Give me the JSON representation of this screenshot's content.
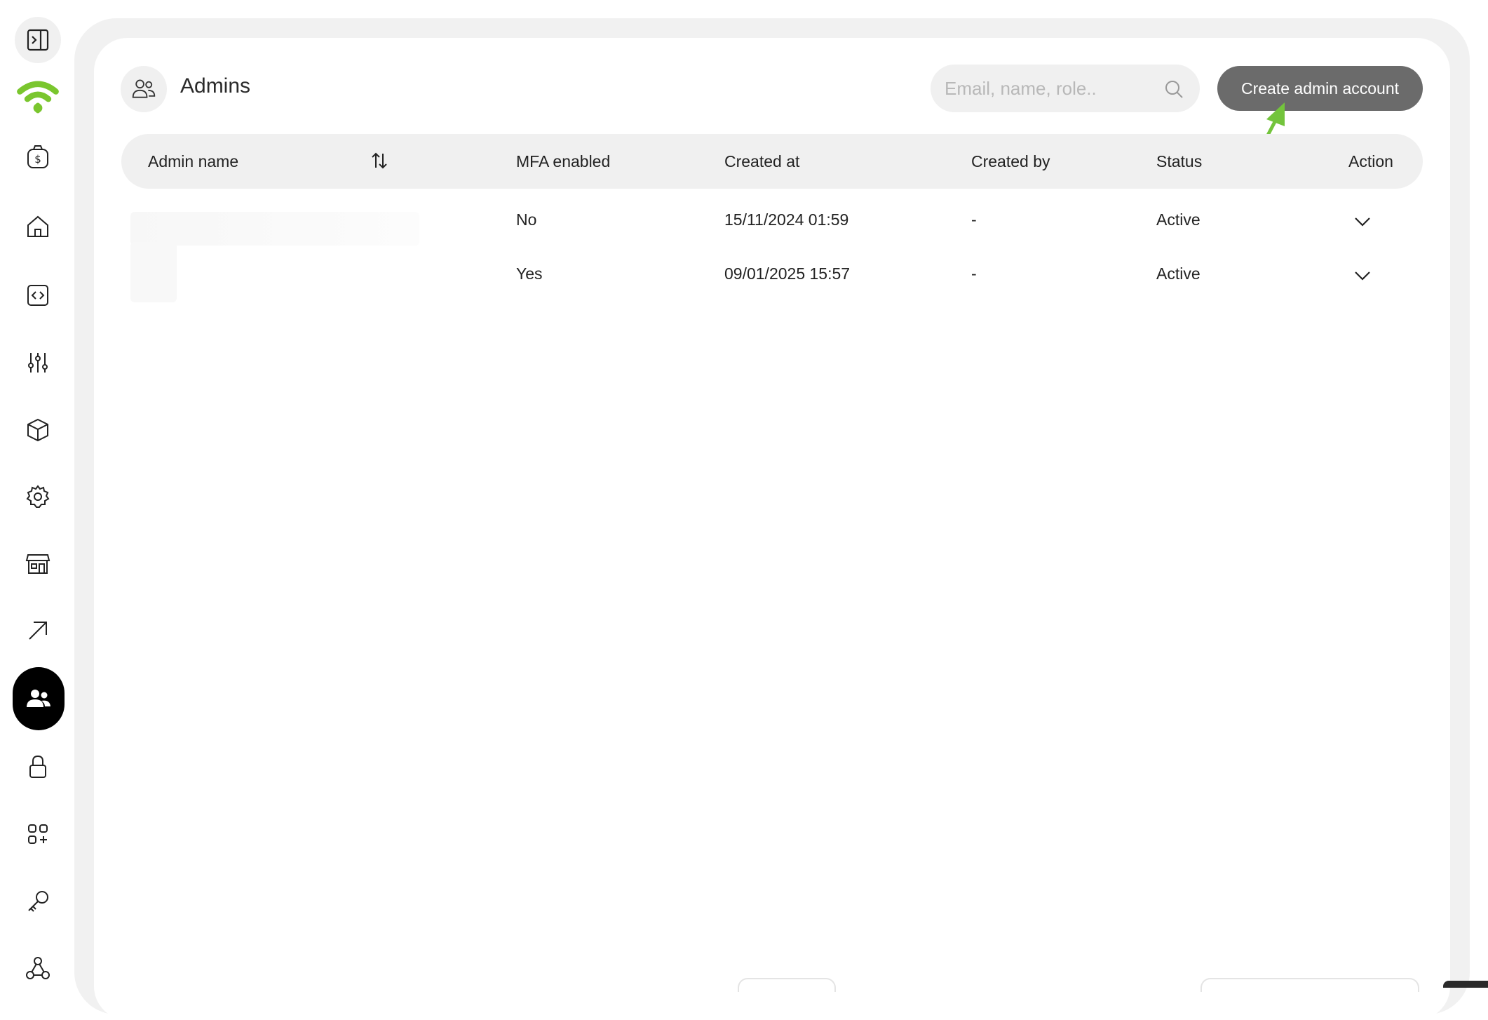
{
  "header": {
    "title": "Admins",
    "search_placeholder": "Email, name, role..",
    "create_button": "Create admin account"
  },
  "table": {
    "columns": [
      "Admin name",
      "MFA enabled",
      "Created at",
      "Created by",
      "Status",
      "Action"
    ],
    "rows": [
      {
        "admin_name": "",
        "mfa_enabled": "No",
        "created_at": "15/11/2024 01:59",
        "created_by": "-",
        "status": "Active"
      },
      {
        "admin_name": "",
        "mfa_enabled": "Yes",
        "created_at": "09/01/2025 15:57",
        "created_by": "-",
        "status": "Active"
      }
    ]
  },
  "sidebar": {
    "items": [
      "sidebar-toggle",
      "wifi-logo",
      "billing",
      "home",
      "code",
      "sliders",
      "box",
      "settings",
      "store",
      "arrow-up-right",
      "users",
      "lock",
      "apps",
      "key",
      "webhook"
    ]
  },
  "colors": {
    "brand_green": "#7ac62e",
    "annotation_arrow": "#73c43c",
    "button_bg": "#6b6b6b",
    "active_nav": "#000000"
  }
}
